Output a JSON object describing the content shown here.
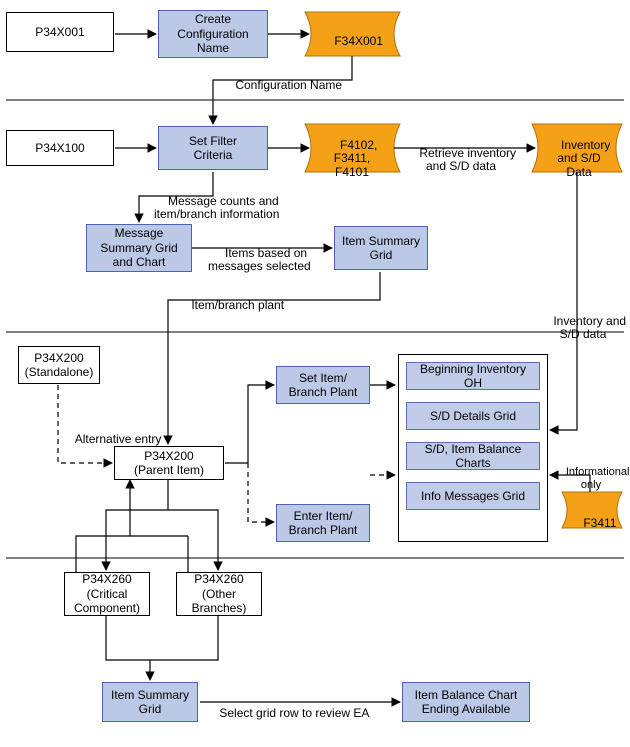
{
  "row1": {
    "p34x001": "P34X001",
    "createConfig": "Create\nConfiguration\nName",
    "f34x001": "F34X001",
    "edge_configName": "Configuration Name"
  },
  "row2": {
    "p34x100": "P34X100",
    "setFilter": "Set Filter\nCriteria",
    "tables": "F4102,\nF3411,\nF4101",
    "edge_retrieve": "Retrieve inventory\nand S/D data",
    "invSdData": "Inventory\nand S/D\nData",
    "edge_msgCounts": "Message counts and\nitem/branch information",
    "msgSummary": "Message\nSummary Grid\nand Chart",
    "edge_itemsBased": "Items based on\nmessages selected",
    "itemSummary": "Item Summary\nGrid",
    "edge_itemBranchPlant": "Item/branch plant",
    "edge_invSdData": "Inventory and\nS/D data"
  },
  "row3": {
    "p34x200Standalone": "P34X200\n(Standalone)",
    "edge_altEntry": "Alternative entry",
    "p34x200Parent": "P34X200\n(Parent Item)",
    "setItemBP": "Set Item/\nBranch Plant",
    "enterItemBP": "Enter Item/\nBranch Plant",
    "box_beginInv": "Beginning Inventory OH",
    "box_sdDetails": "S/D Details Grid",
    "box_sdBalance": "S/D, Item Balance Charts",
    "box_infoMsg": "Info Messages Grid",
    "edge_infoOnly": "Informational only",
    "f3411": "F3411"
  },
  "row4": {
    "p34x260Crit": "P34X260\n(Critical\nComponent)",
    "p34x260Other": "P34X260\n(Other\nBranches)",
    "itemSummaryGrid": "Item Summary\nGrid",
    "edge_selectGrid": "Select grid row to review EA",
    "itemBalanceChart": "Item Balance Chart\nEnding Available"
  }
}
